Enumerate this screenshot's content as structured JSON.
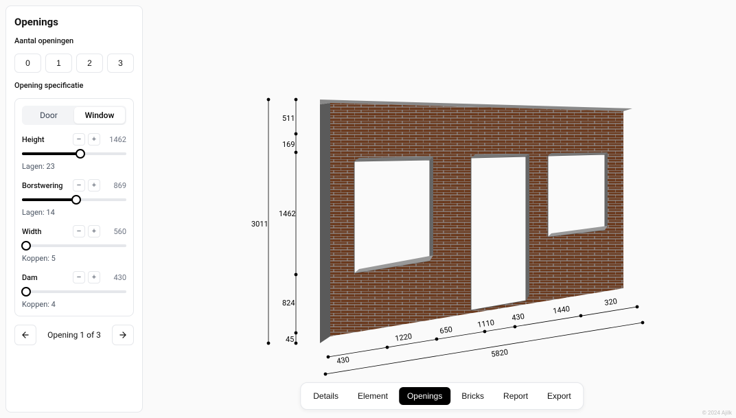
{
  "panel": {
    "title": "Openings",
    "count_label": "Aantal openingen",
    "counts": [
      "0",
      "1",
      "2",
      "3"
    ],
    "spec_label": "Opening specificatie",
    "type_door": "Door",
    "type_window": "Window",
    "type_active": "Window",
    "sliders": {
      "height": {
        "label": "Height",
        "value": "1462",
        "sub": "Lagen: 23",
        "fill_pct": 56
      },
      "borstwering": {
        "label": "Borstwering",
        "value": "869",
        "sub": "Lagen: 14",
        "fill_pct": 52
      },
      "width": {
        "label": "Width",
        "value": "560",
        "sub": "Koppen: 5",
        "fill_pct": 0
      },
      "dam": {
        "label": "Dam",
        "value": "430",
        "sub": "Koppen: 4",
        "fill_pct": 0
      }
    },
    "nav_text": "Opening 1 of 3"
  },
  "tabs": {
    "items": [
      "Details",
      "Element",
      "Openings",
      "Bricks",
      "Report",
      "Export"
    ],
    "active": "Openings"
  },
  "diagram": {
    "height_total": "3011",
    "bottom_margin": "45",
    "parapet": "824",
    "window_h": "1462",
    "gap_169": "169",
    "top_511": "511",
    "footer_430": "430",
    "footer_total": "5820",
    "seg_1220": "1220",
    "seg_650": "650",
    "seg_1110": "1110",
    "seg_430": "430",
    "seg_1440": "1440",
    "seg_320": "320"
  },
  "copyright": "© 2024 Ajilk"
}
